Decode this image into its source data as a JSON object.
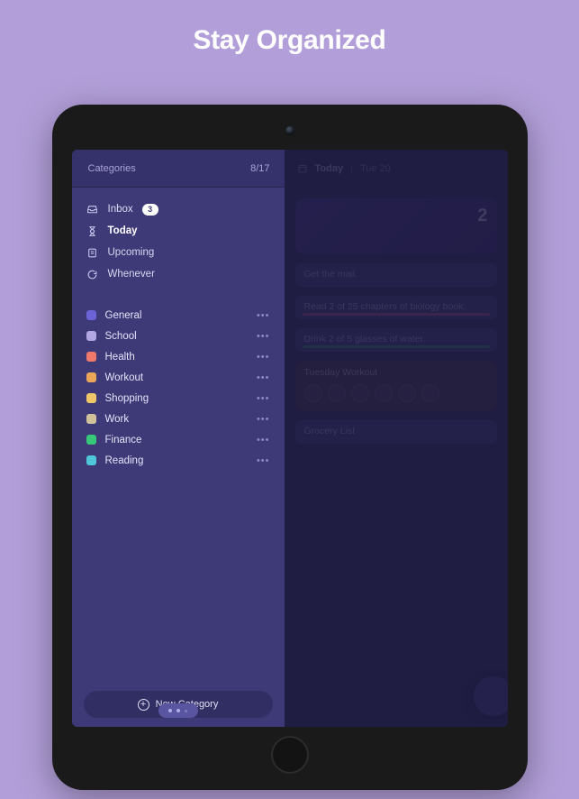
{
  "headline": "Stay Organized",
  "sidebar": {
    "header_title": "Categories",
    "header_date": "8/17",
    "nav": [
      {
        "icon": "inbox-icon",
        "label": "Inbox",
        "badge": "3",
        "active": false
      },
      {
        "icon": "hourglass-icon",
        "label": "Today",
        "badge": null,
        "active": true
      },
      {
        "icon": "note-icon",
        "label": "Upcoming",
        "badge": null,
        "active": false
      },
      {
        "icon": "refresh-icon",
        "label": "Whenever",
        "badge": null,
        "active": false
      }
    ],
    "categories": [
      {
        "label": "General",
        "color": "#6b63d6"
      },
      {
        "label": "School",
        "color": "#b3a7e3"
      },
      {
        "label": "Health",
        "color": "#ef7a6b"
      },
      {
        "label": "Workout",
        "color": "#eba65a"
      },
      {
        "label": "Shopping",
        "color": "#efc768"
      },
      {
        "label": "Work",
        "color": "#cfc29b"
      },
      {
        "label": "Finance",
        "color": "#36c77b"
      },
      {
        "label": "Reading",
        "color": "#4fc7d8"
      }
    ],
    "new_category_label": "New Category"
  },
  "main": {
    "title_bold": "Today",
    "title_sub": "Tue 20",
    "hero_count": "2",
    "tasks": [
      {
        "label": "Get the mail.",
        "variant": null
      },
      {
        "label": "Read 2 of 25 chapters of biology book.",
        "variant": "pink"
      },
      {
        "label": "Drink 2 of 5 glasses of water.",
        "variant": "green"
      }
    ],
    "workout_title": "Tuesday Workout",
    "grocery_title": "Grocery List"
  }
}
